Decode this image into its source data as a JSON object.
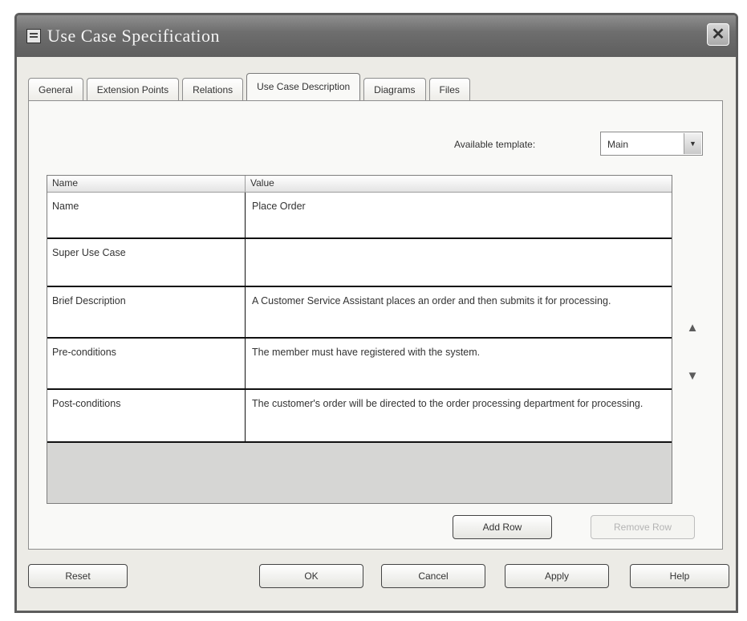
{
  "window": {
    "title": "Use Case Specification",
    "close_glyph": "✕"
  },
  "tabs": [
    {
      "label": "General"
    },
    {
      "label": "Extension Points"
    },
    {
      "label": "Relations"
    },
    {
      "label": "Use Case Description",
      "active": true
    },
    {
      "label": "Diagrams"
    },
    {
      "label": "Files"
    }
  ],
  "template": {
    "label": "Available template:",
    "value": "Main"
  },
  "table": {
    "headers": {
      "name": "Name",
      "value": "Value"
    },
    "rows": [
      {
        "name": "Name",
        "value": "Place Order"
      },
      {
        "name": "Super Use Case",
        "value": ""
      },
      {
        "name": "Brief Description",
        "value": "A Customer Service Assistant places an order and then submits it for processing."
      },
      {
        "name": "Pre-conditions",
        "value": "The member must have registered with the system."
      },
      {
        "name": "Post-conditions",
        "value": "The customer's order will be directed to the order processing department for processing."
      }
    ]
  },
  "row_buttons": {
    "add": "Add Row",
    "remove": "Remove Row"
  },
  "footer": {
    "reset": "Reset",
    "ok": "OK",
    "cancel": "Cancel",
    "apply": "Apply",
    "help": "Help"
  },
  "icons": {
    "move_up": "up-arrow-icon",
    "move_down": "down-arrow-icon",
    "app": "window-icon"
  }
}
